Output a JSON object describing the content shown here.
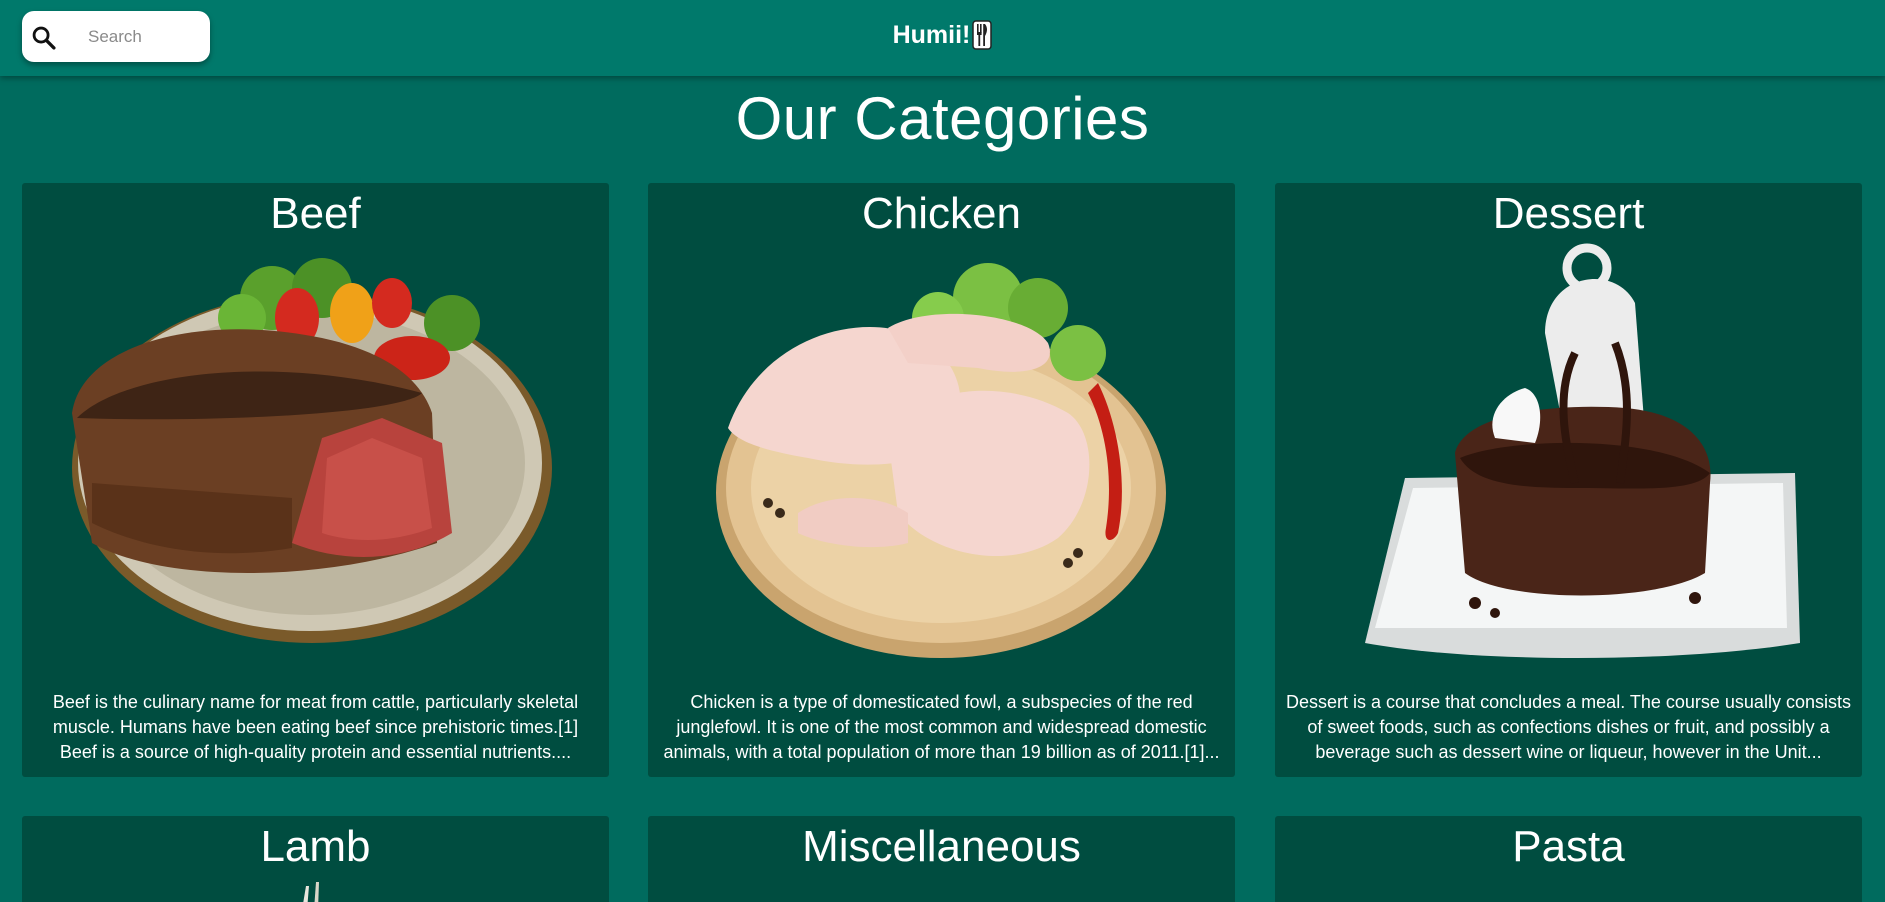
{
  "header": {
    "search_placeholder": "Search",
    "brand": "Humii!"
  },
  "page_title": "Our Categories",
  "categories": [
    {
      "name": "Beef",
      "description": "Beef is the culinary name for meat from cattle, particularly skeletal muscle. Humans have been eating beef since prehistoric times.[1] Beef is a source of high-quality protein and essential nutrients...."
    },
    {
      "name": "Chicken",
      "description": "Chicken is a type of domesticated fowl, a subspecies of the red junglefowl. It is one of the most common and widespread domestic animals, with a total population of more than 19 billion as of 2011.[1]..."
    },
    {
      "name": "Dessert",
      "description": "Dessert is a course that concludes a meal. The course usually consists of sweet foods, such as confections dishes or fruit, and possibly a beverage such as dessert wine or liqueur, however in the Unit..."
    },
    {
      "name": "Lamb"
    },
    {
      "name": "Miscellaneous"
    },
    {
      "name": "Pasta"
    }
  ],
  "colors": {
    "background": "#006b5e",
    "appbar": "#00796b",
    "card": "#004d40"
  }
}
